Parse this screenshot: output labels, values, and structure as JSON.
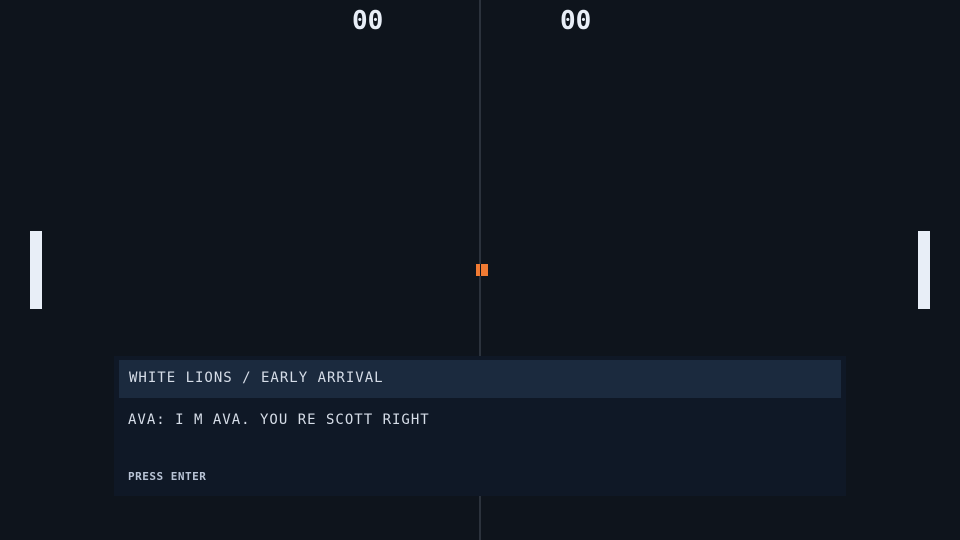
{
  "scoreboard": {
    "left_score": "00",
    "right_score": "00"
  },
  "colors": {
    "background": "#0e141c",
    "paddle": "#e8eef7",
    "ball": "#f07a33",
    "dialog_bg": "#0f1826",
    "dialog_header_bg": "#1b2a3e"
  },
  "dialog": {
    "title": "WHITE LIONS / EARLY ARRIVAL",
    "line": "AVA: I M AVA. YOU RE SCOTT  RIGHT",
    "prompt": "PRESS ENTER"
  }
}
